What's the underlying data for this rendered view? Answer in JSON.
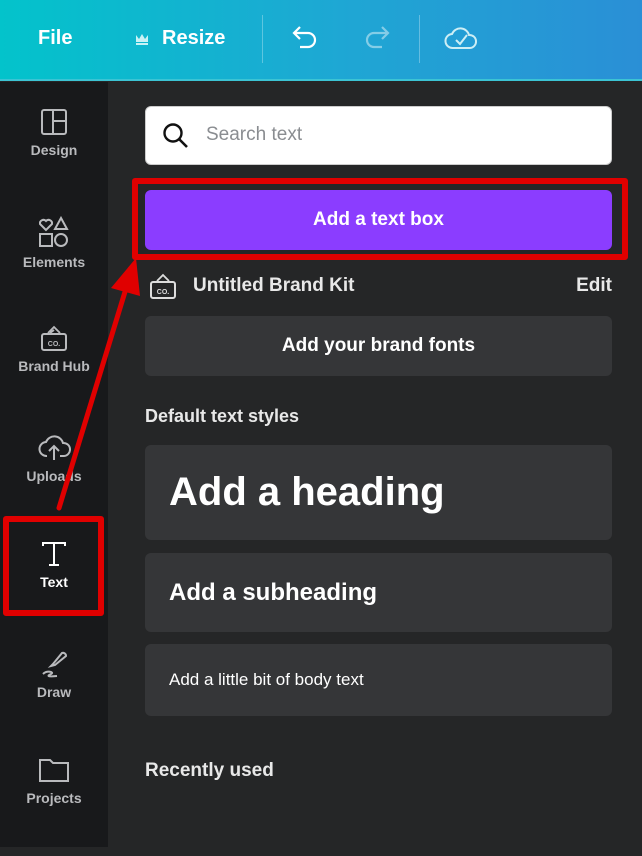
{
  "header": {
    "file": "File",
    "resize": "Resize"
  },
  "sidebar": {
    "items": [
      {
        "label": "Design"
      },
      {
        "label": "Elements"
      },
      {
        "label": "Brand Hub"
      },
      {
        "label": "Uploads"
      },
      {
        "label": "Text"
      },
      {
        "label": "Draw"
      },
      {
        "label": "Projects"
      }
    ],
    "active": "Text"
  },
  "panel": {
    "search_placeholder": "Search text",
    "add_text_box": "Add a text box",
    "brand_kit": "Untitled Brand Kit",
    "edit": "Edit",
    "add_brand_fonts": "Add your brand fonts",
    "default_styles": "Default text styles",
    "heading": "Add a heading",
    "subheading": "Add a subheading",
    "body": "Add a little bit of body text",
    "recently_used": "Recently used"
  },
  "colors": {
    "accent": "#8b3dff",
    "annotation": "#e00000"
  }
}
